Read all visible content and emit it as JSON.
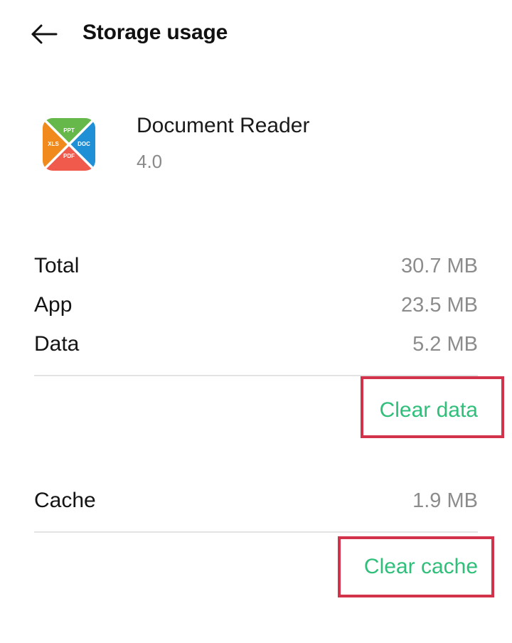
{
  "header": {
    "title": "Storage usage",
    "back_icon": "arrow-left-icon"
  },
  "app": {
    "name": "Document Reader",
    "version": "4.0",
    "icon": {
      "name": "document-reader-app-icon",
      "labels": [
        "PPT",
        "XLS",
        "DOC",
        "PDF"
      ],
      "colors": {
        "top": "#67b84a",
        "left": "#f08a1c",
        "right": "#1f8fd6",
        "bottom": "#f05a4d"
      }
    }
  },
  "storage": {
    "rows": [
      {
        "label": "Total",
        "value": "30.7 MB"
      },
      {
        "label": "App",
        "value": "23.5 MB"
      },
      {
        "label": "Data",
        "value": "5.2 MB"
      }
    ],
    "clear_data_label": "Clear data",
    "cache": {
      "label": "Cache",
      "value": "1.9 MB"
    },
    "clear_cache_label": "Clear cache"
  },
  "colors": {
    "accent": "#2fbf7a",
    "highlight": "#d3334a",
    "secondary_text": "#8c8c8c"
  }
}
